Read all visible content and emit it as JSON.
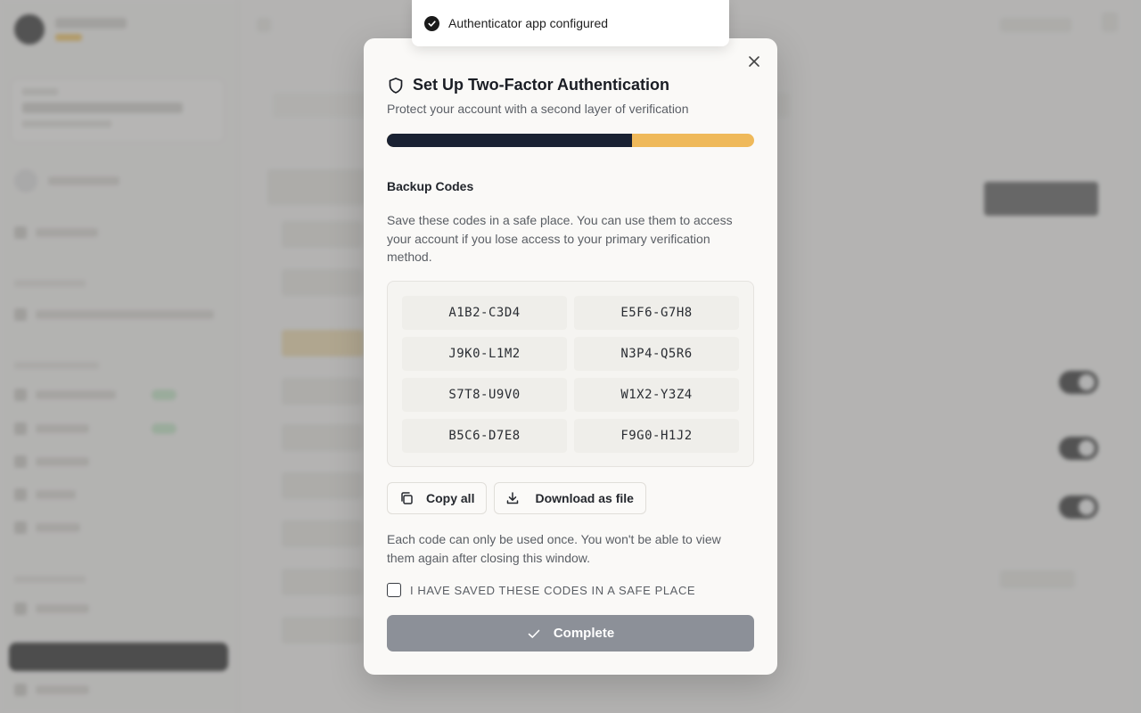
{
  "toast": {
    "message": "Authenticator app configured",
    "icon": "check-circle-icon"
  },
  "modal": {
    "title": "Set Up Two-Factor Authentication",
    "title_icon": "shield-icon",
    "subtitle": "Protect your account with a second layer of verification",
    "progress_fraction": 0.667,
    "progress_colors": {
      "filled": "#1a2233",
      "remaining": "#efb95a"
    },
    "section_title": "Backup Codes",
    "section_description": "Save these codes in a safe place. You can use them to access your account if you lose access to your primary verification method.",
    "codes": [
      "A1B2-C3D4",
      "E5F6-G7H8",
      "J9K0-L1M2",
      "N3P4-Q5R6",
      "S7T8-U9V0",
      "W1X2-Y3Z4",
      "B5C6-D7E8",
      "F9G0-H1J2"
    ],
    "copy_all_label": "Copy all",
    "download_label": "Download as file",
    "note": "Each code can only be used once. You won't be able to view them again after closing this window.",
    "checkbox_label": "I HAVE SAVED THESE CODES IN A SAFE PLACE",
    "checkbox_checked": false,
    "complete_label": "Complete",
    "complete_enabled": false
  }
}
